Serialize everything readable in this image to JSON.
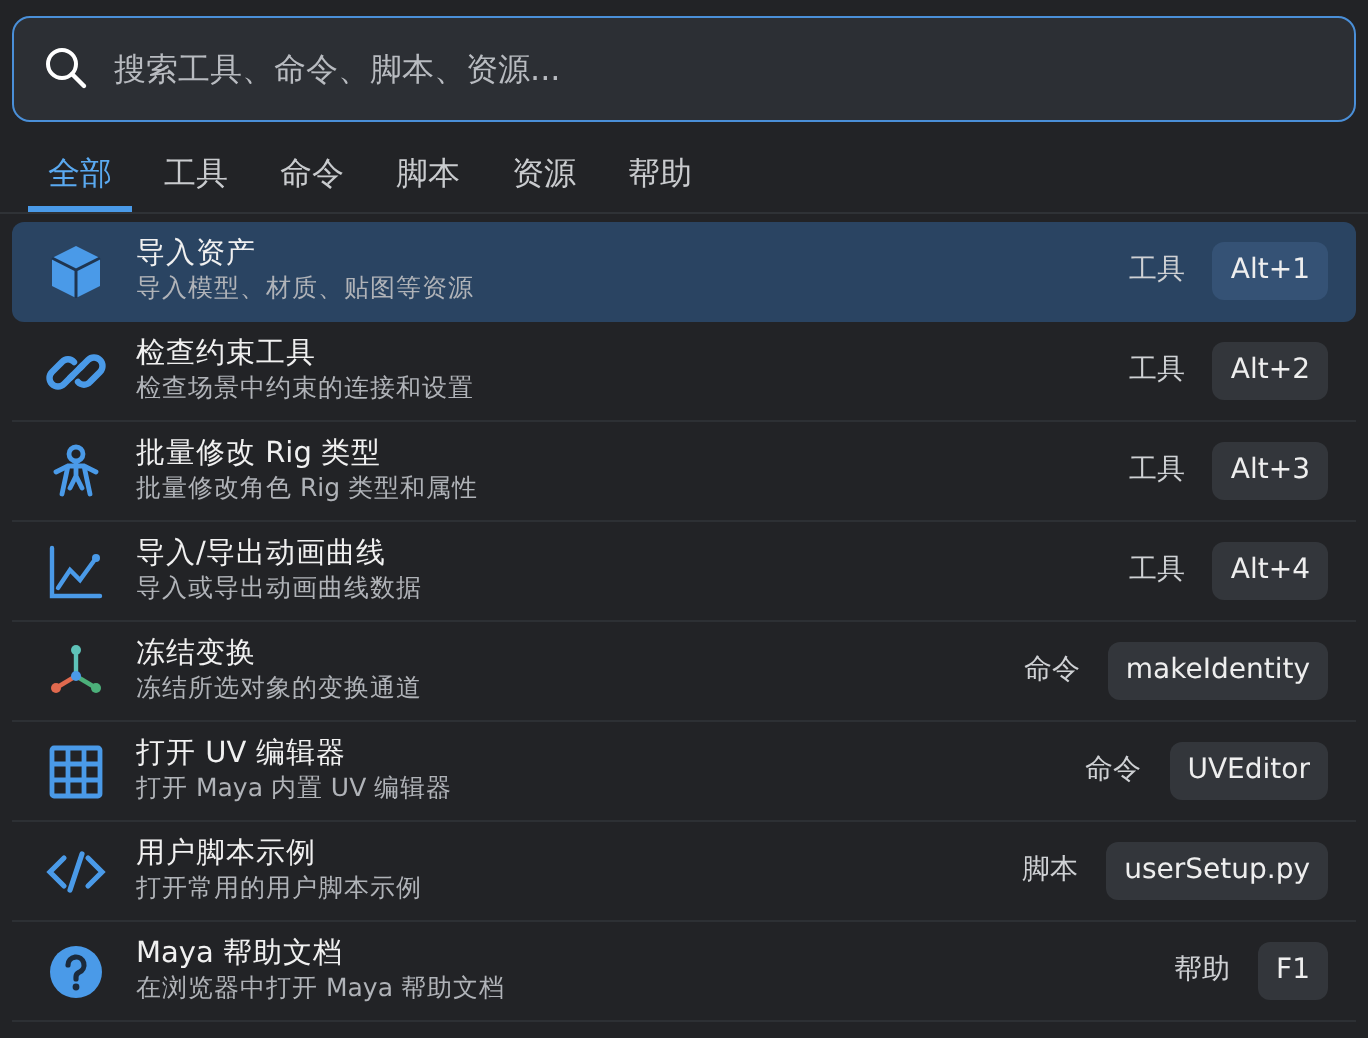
{
  "search": {
    "placeholder": "搜索工具、命令、脚本、资源..."
  },
  "tabs": [
    {
      "label": "全部",
      "selected": true
    },
    {
      "label": "工具",
      "selected": false
    },
    {
      "label": "命令",
      "selected": false
    },
    {
      "label": "脚本",
      "selected": false
    },
    {
      "label": "资源",
      "selected": false
    },
    {
      "label": "帮助",
      "selected": false
    }
  ],
  "results": [
    {
      "title": "导入资产",
      "subtitle": "导入模型、材质、贴图等资源",
      "category": "工具",
      "shortcut": "Alt+1",
      "selected": true
    },
    {
      "title": "检查约束工具",
      "subtitle": "检查场景中约束的连接和设置",
      "category": "工具",
      "shortcut": "Alt+2",
      "selected": false
    },
    {
      "title": "批量修改 Rig 类型",
      "subtitle": "批量修改角色 Rig 类型和属性",
      "category": "工具",
      "shortcut": "Alt+3",
      "selected": false
    },
    {
      "title": "导入/导出动画曲线",
      "subtitle": "导入或导出动画曲线数据",
      "category": "工具",
      "shortcut": "Alt+4",
      "selected": false
    },
    {
      "title": "冻结变换",
      "subtitle": "冻结所选对象的变换通道",
      "category": "命令",
      "shortcut": "makeIdentity",
      "selected": false
    },
    {
      "title": "打开 UV 编辑器",
      "subtitle": "打开 Maya 内置 UV 编辑器",
      "category": "命令",
      "shortcut": "UVEditor",
      "selected": false
    },
    {
      "title": "用户脚本示例",
      "subtitle": "打开常用的用户脚本示例",
      "category": "脚本",
      "shortcut": "userSetup.py",
      "selected": false
    },
    {
      "title": "Maya 帮助文档",
      "subtitle": "在浏览器中打开 Maya 帮助文档",
      "category": "帮助",
      "shortcut": "F1",
      "selected": false
    }
  ]
}
